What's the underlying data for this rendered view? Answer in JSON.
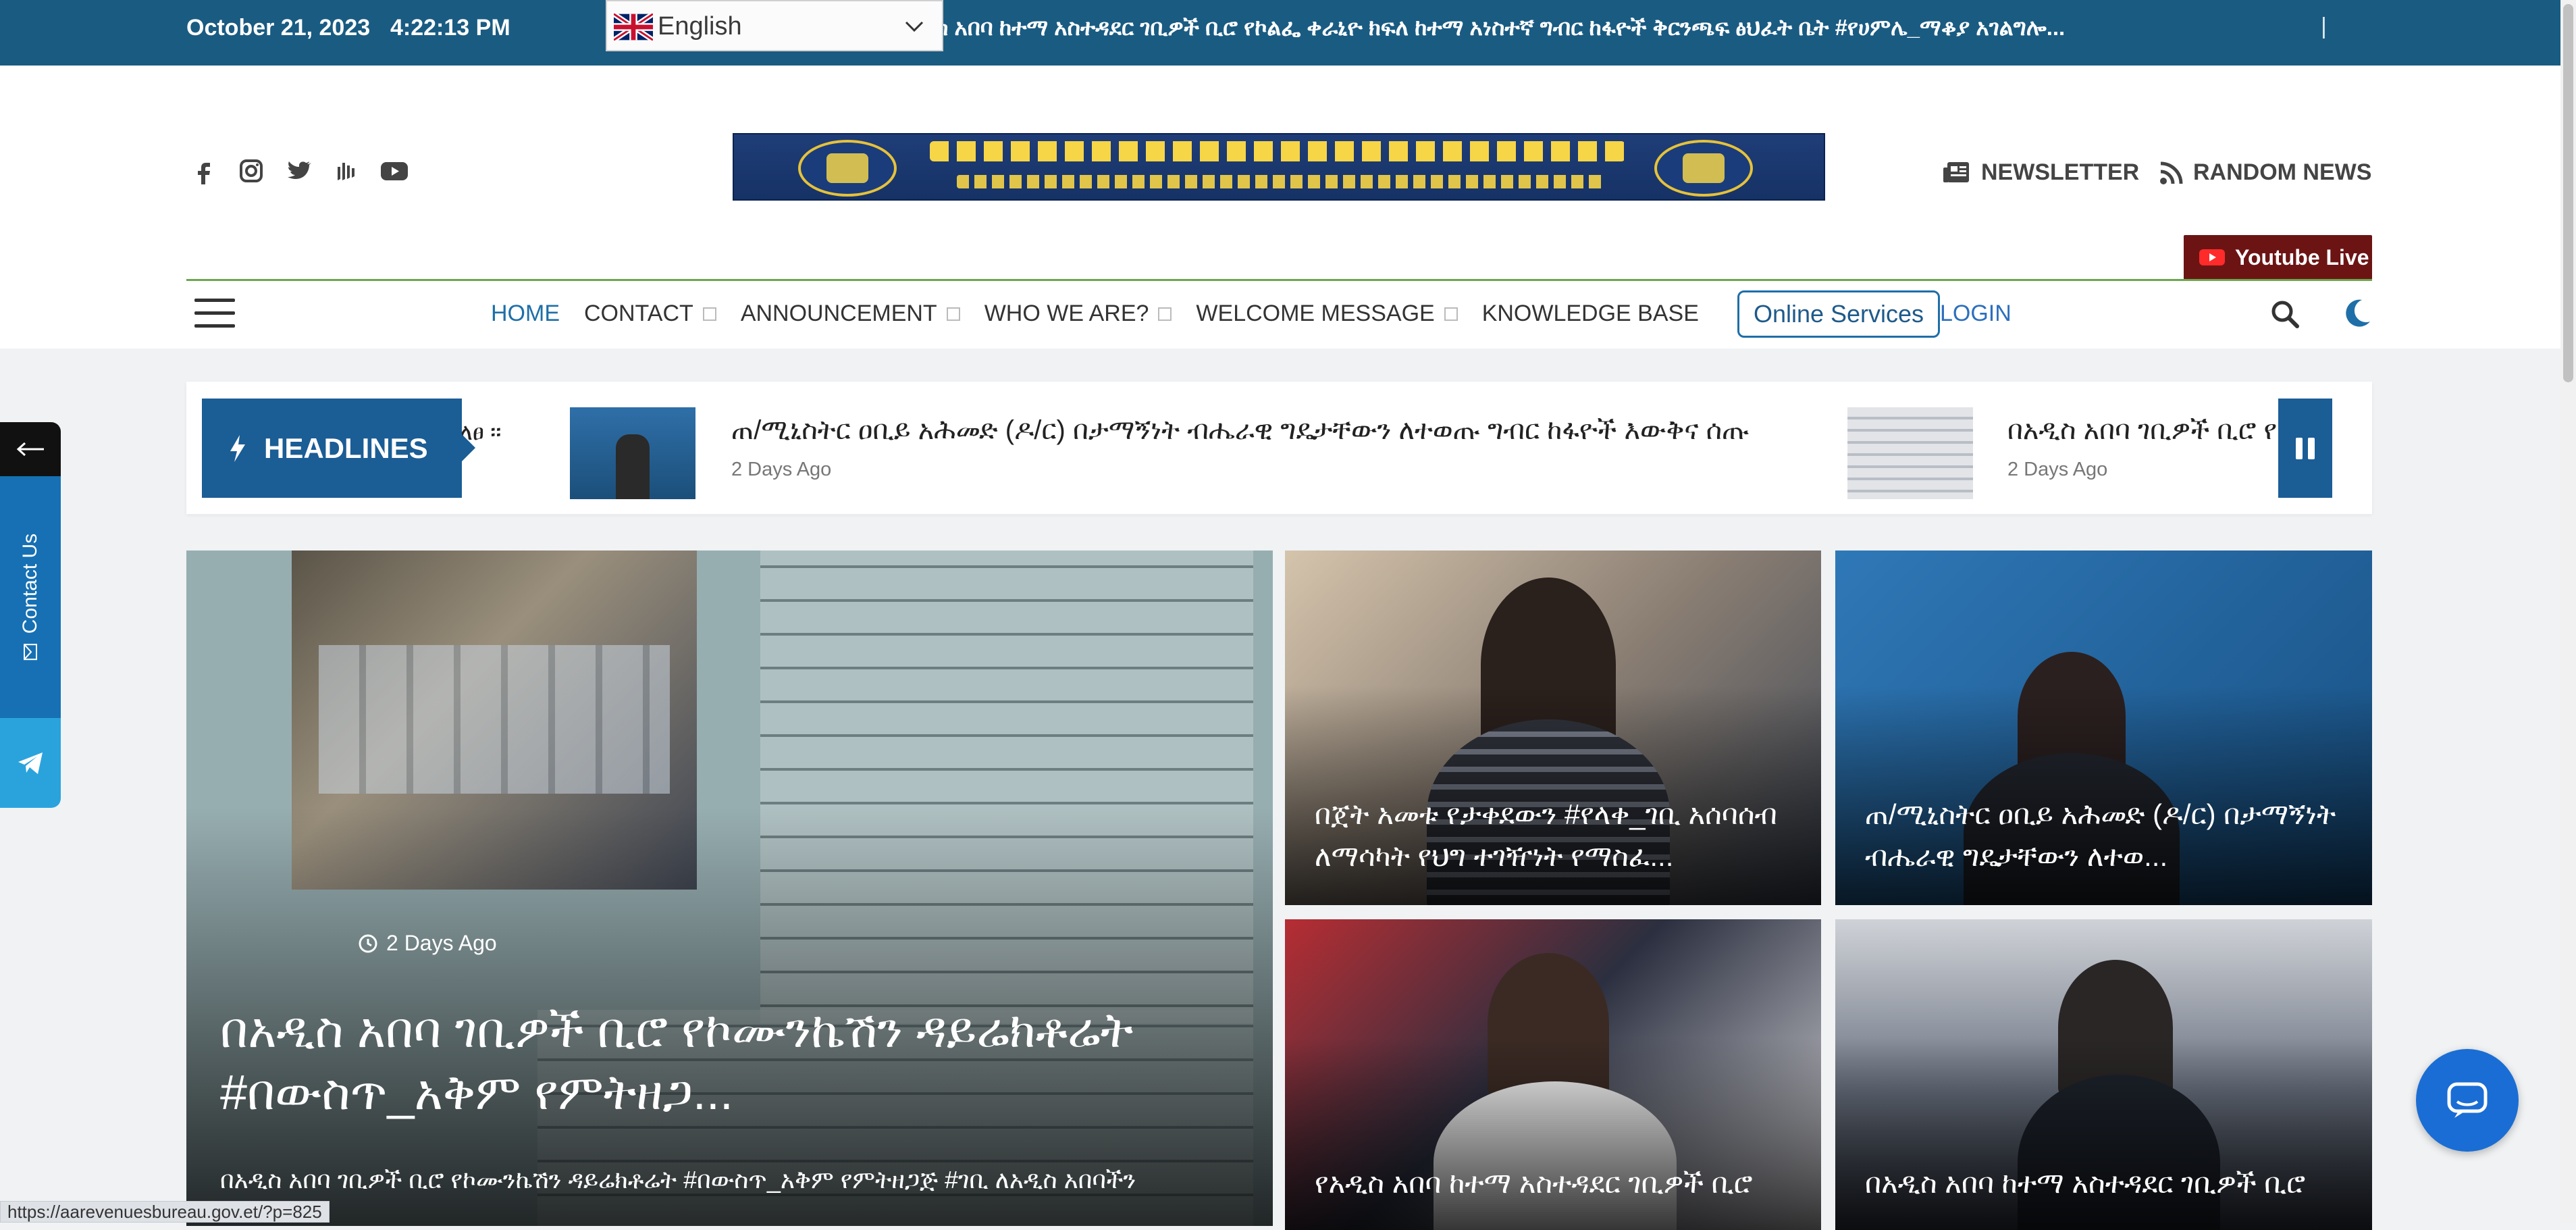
{
  "topbar": {
    "date": "October 21, 2023",
    "time": "4:22:13 PM",
    "ticker": "ስ አበባ ከተማ አስተዳደር ገቢዎች ቢሮ የኮልፌ ቀራኒዮ ክፍለ ከተማ አነስተኛ ግብር ከፋዮች ቅርንጫፍ ፅህፈት ቤት #የሀምሌ_ማቆያ አገልግሎ...",
    "language": "English"
  },
  "header": {
    "social_icons": [
      "facebook-icon",
      "instagram-icon",
      "twitter-icon",
      "tiktok-icon",
      "youtube-icon"
    ],
    "newsletter": "NEWSLETTER",
    "random_news": "RANDOM NEWS",
    "youtube_live": "Youtube Live"
  },
  "nav": {
    "items": [
      {
        "label": "HOME",
        "active": true,
        "dropdown": false
      },
      {
        "label": "CONTACT",
        "dropdown": true
      },
      {
        "label": "ANNOUNCEMENT",
        "dropdown": true
      },
      {
        "label": "WHO WE ARE?",
        "dropdown": true
      },
      {
        "label": "WELCOME MESSAGE",
        "dropdown": true
      },
      {
        "label": "KNOWLEDGE BASE",
        "dropdown": false
      }
    ],
    "online_services": "Online Services",
    "login": "LOGIN"
  },
  "headlines": {
    "badge": "HEADLINES",
    "fragment": "ለፀ ፡፡",
    "items": [
      {
        "title": "ጠ/ሚኒስትር ዐቢይ አሕመድ (ዶ/ር) በታማኝነት ብሔራዊ ግዴታቸውን ለተወጡ ግብር ከፋዮች እውቅና ሰጡ",
        "date": "2 Days Ago"
      },
      {
        "title": "በአዲስ አበባ ገቢዎች ቢሮ የኮ",
        "date": "2 Days Ago"
      }
    ]
  },
  "feature": {
    "date": "2 Days Ago",
    "title": "በአዲስ አበባ ገቢዎች ቢሮ የኮሙንኬሽን ዳይሬክቶሬት #በውስጥ_አቅም የምትዘጋ...",
    "excerpt": "በአዲስ አበባ ገቢዎች ቢሮ የኮሙንኬሽን ዳይሬክቶሬት #በውስጥ_አቅም የምትዘጋጅ #ገቢ ለአዲስ አበባችን"
  },
  "cards": [
    {
      "title": "በጀት አመቱ የታቀደውን #የላቀ_ገቢ አሰባሰብ ለማሳካት የህግ ተገዥነት የማስፈ..."
    },
    {
      "title": "ጠ/ሚኒስትር ዐቢይ አሕመድ (ዶ/ር) በታማኝነት ብሔራዊ ግዴታቸውን ለተወ..."
    },
    {
      "title": "የአዲስ አበባ ከተማ አስተዳደር ገቢዎች ቢሮ"
    },
    {
      "title": "በአዲስ አበባ ከተማ አስተዳደር ገቢዎች ቢሮ"
    }
  ],
  "sidebar": {
    "contact_us": "Contact Us"
  },
  "status_url": "https://aarevenuesbureau.gov.et/?p=825",
  "colors": {
    "topbar": "#1a5b82",
    "primary": "#1b5d95",
    "youtube_live": "#6c1414",
    "telegram": "#2aa3dd",
    "chat": "#1a6dd4"
  }
}
